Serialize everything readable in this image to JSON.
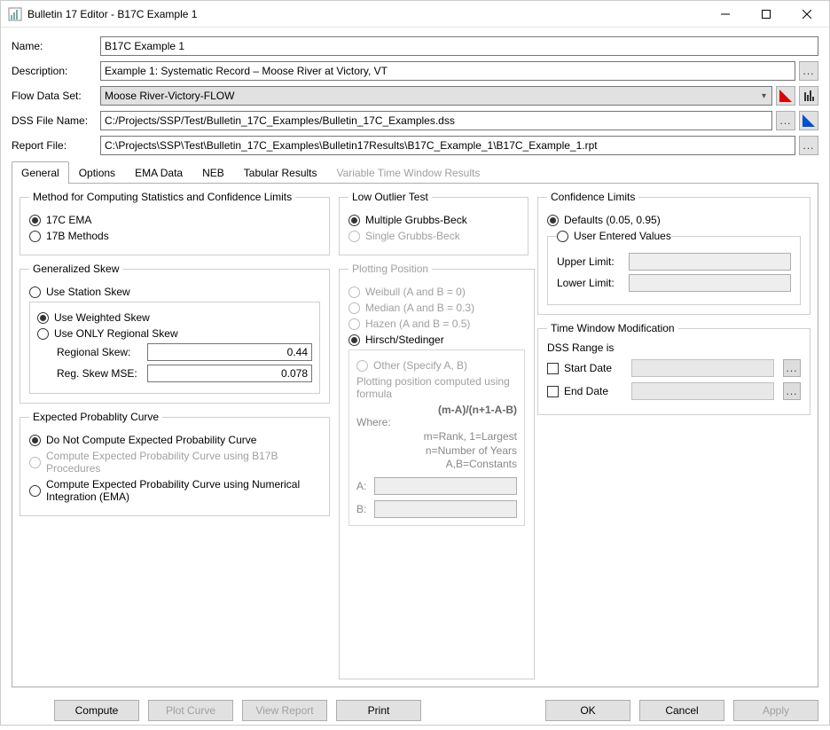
{
  "window": {
    "title": "Bulletin 17 Editor - B17C Example 1"
  },
  "fields": {
    "name": {
      "label": "Name:",
      "value": "B17C Example 1"
    },
    "description": {
      "label": "Description:",
      "value": "Example 1: Systematic Record – Moose River at Victory, VT"
    },
    "flow_data_set": {
      "label": "Flow Data Set:",
      "value": "Moose River-Victory-FLOW"
    },
    "dss_file_name": {
      "label": "DSS File Name:",
      "value": "C:/Projects/SSP/Test/Bulletin_17C_Examples/Bulletin_17C_Examples.dss"
    },
    "report_file": {
      "label": "Report File:",
      "value": "C:\\Projects\\SSP\\Test\\Bulletin_17C_Examples\\Bulletin17Results\\B17C_Example_1\\B17C_Example_1.rpt"
    }
  },
  "tabs": [
    {
      "label": "General",
      "active": true
    },
    {
      "label": "Options"
    },
    {
      "label": "EMA Data"
    },
    {
      "label": "NEB"
    },
    {
      "label": "Tabular Results"
    },
    {
      "label": "Variable Time Window Results",
      "disabled": true
    }
  ],
  "method": {
    "legend": "Method for Computing Statistics and Confidence Limits",
    "opt1": "17C EMA",
    "opt2": "17B Methods",
    "selected": "17C EMA"
  },
  "gen_skew": {
    "legend": "Generalized Skew",
    "use_station": "Use Station Skew",
    "use_weighted": "Use Weighted Skew",
    "use_only_regional": "Use ONLY Regional Skew",
    "regional_skew_label": "Regional Skew:",
    "regional_skew_value": "0.44",
    "reg_skew_mse_label": "Reg. Skew MSE:",
    "reg_skew_mse_value": "0.078"
  },
  "expected": {
    "legend": "Expected Probablity Curve",
    "opt1": "Do Not Compute Expected Probability Curve",
    "opt2": "Compute Expected Probability Curve using B17B Procedures",
    "opt3": "Compute Expected Probability Curve using Numerical Integration (EMA)"
  },
  "low_outlier": {
    "legend": "Low Outlier Test",
    "opt1": "Multiple Grubbs-Beck",
    "opt2": "Single Grubbs-Beck"
  },
  "plotting": {
    "legend": "Plotting Position",
    "opt1": "Weibull (A and B = 0)",
    "opt2": "Median (A and B = 0.3)",
    "opt3": "Hazen (A and B = 0.5)",
    "opt4": "Hirsch/Stedinger",
    "opt5": "Other (Specify A, B)",
    "computed_text": "Plotting position computed using formula",
    "formula": "(m-A)/(n+1-A-B)",
    "where": "Where:",
    "where1": "m=Rank, 1=Largest",
    "where2": "n=Number of Years",
    "where3": "A,B=Constants",
    "a_label": "A:",
    "b_label": "B:"
  },
  "confidence": {
    "legend": "Confidence Limits",
    "defaults": "Defaults (0.05, 0.95)",
    "user": "User Entered Values",
    "upper_label": "Upper Limit:",
    "lower_label": "Lower Limit:"
  },
  "time_window": {
    "legend": "Time Window Modification",
    "dss_range": "DSS Range is",
    "start_date": "Start Date",
    "end_date": "End Date"
  },
  "buttons": {
    "compute": "Compute",
    "plot": "Plot Curve",
    "view": "View Report",
    "print": "Print",
    "ok": "OK",
    "cancel": "Cancel",
    "apply": "Apply"
  }
}
